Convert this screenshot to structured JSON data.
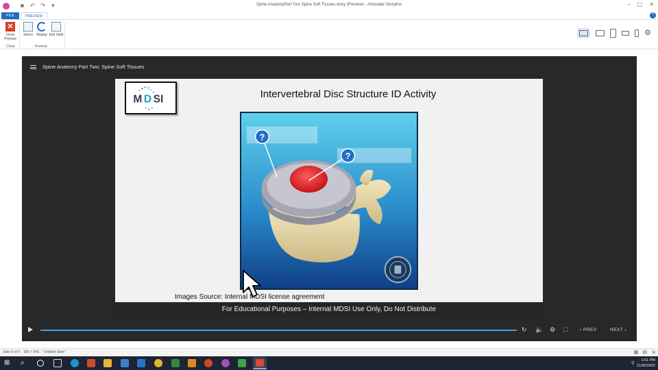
{
  "window": {
    "title": "Spine AnatomyPart Two Spine Soft Tissues.story (Preview) - Articulate Storyline",
    "controls": [
      "–",
      "▢",
      "✕"
    ]
  },
  "ribbon": {
    "tabs": [
      {
        "label": "FILE"
      },
      {
        "label": "PREVIEW"
      }
    ],
    "buttons": [
      {
        "label": "Close Preview"
      },
      {
        "label": "Select"
      },
      {
        "label": "Replay"
      },
      {
        "label": "Edit Slide"
      }
    ],
    "groups": [
      {
        "label": "Close"
      },
      {
        "label": "Preview"
      }
    ],
    "devices": [
      "desktop",
      "tablet-landscape",
      "tablet-portrait",
      "phone-landscape",
      "phone-portrait"
    ]
  },
  "player": {
    "course_title": "Spine Anatomy Part Two: Spine Soft Tissues",
    "slide": {
      "logo_text": "MDSI",
      "title": "Intervertebral Disc Structure ID Activity",
      "hotspots": [
        {
          "label": "?"
        },
        {
          "label": "?"
        }
      ],
      "image_source": "Images Source: Internal MDSI license agreement"
    },
    "footer_note": "For Educational Purposes – Internal MDSI Use Only, Do Not Distribute",
    "controls": {
      "prev_label": "PREV",
      "next_label": "NEXT"
    },
    "progress": 0.0
  },
  "status": {
    "slide_info": "Slide 9 of 9",
    "size": "960 × 540",
    "scene": "\"Untitled Slide\""
  },
  "taskbar": {
    "time": "1:01 PM",
    "date": "11/30/2022",
    "colors": {
      "background": "#1d2432",
      "brand_blue": "#1e6dbd",
      "seek": "#4b9de0"
    }
  }
}
